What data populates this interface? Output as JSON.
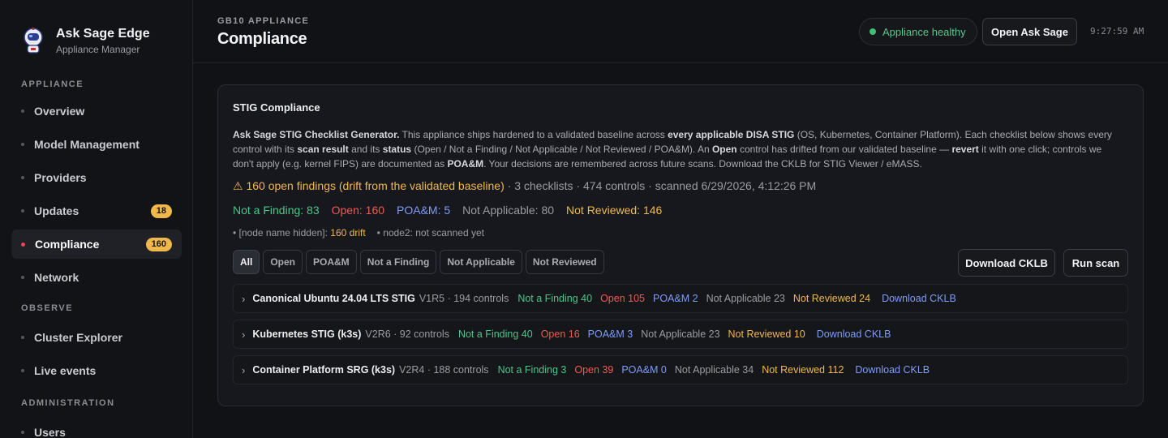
{
  "brand": {
    "title": "Ask Sage Edge",
    "subtitle": "Appliance Manager",
    "logo_icon": "astronaut-logo"
  },
  "sidebar": {
    "sections": [
      {
        "label": "APPLIANCE"
      },
      {
        "label": "OBSERVE"
      },
      {
        "label": "ADMINISTRATION"
      }
    ],
    "items": [
      {
        "label": "Overview"
      },
      {
        "label": "Model Management"
      },
      {
        "label": "Providers"
      },
      {
        "label": "Updates",
        "badge": "18"
      },
      {
        "label": "Compliance",
        "badge": "160",
        "active": true
      },
      {
        "label": "Network"
      },
      {
        "label": "Cluster Explorer"
      },
      {
        "label": "Live events"
      },
      {
        "label": "Users"
      }
    ]
  },
  "header": {
    "eyebrow": "GB10 APPLIANCE",
    "title": "Compliance",
    "health": "Appliance healthy",
    "open_button": "Open Ask Sage",
    "time": "9:27:59 AM"
  },
  "card": {
    "title": "STIG Compliance",
    "desc": {
      "p1": "Ask Sage STIG Checklist Generator.",
      "p2": " This appliance ships hardened to a validated baseline across ",
      "p3": "every applicable DISA STIG",
      "p4": " (OS, Kubernetes, Container Platform). Each checklist below shows every control with its ",
      "p5": "scan result",
      "p6": " and its ",
      "p7": "status",
      "p8": " (Open / Not a Finding / Not Applicable / Not Reviewed / POA&M). An ",
      "p9": "Open",
      "p10": " control has drifted from our validated baseline — ",
      "p11": "revert",
      "p12": " it with one click; controls we don't apply (e.g. kernel FIPS) are documented as ",
      "p13": "POA&M",
      "p14": ". Your decisions are remembered across future scans. Download the CKLB for STIG Viewer / eMASS."
    },
    "alert": {
      "warning": "⚠ 160 open findings (drift from the validated baseline)",
      "rest": " · 3 checklists · 474 controls · scanned 6/29/2026, 4:12:26 PM"
    },
    "counts": {
      "not_a_finding": "Not a Finding: 83",
      "open": "Open: 160",
      "poam": "POA&M: 5",
      "not_applicable": "Not Applicable: 80",
      "not_reviewed": "Not Reviewed: 146"
    },
    "nodes": {
      "node1_label": "• [node name hidden]: ",
      "node1_drift": "160 drift",
      "node2": "• node2: not scanned yet"
    },
    "filters": [
      "All",
      "Open",
      "POA&M",
      "Not a Finding",
      "Not Applicable",
      "Not Reviewed"
    ],
    "download_button": "Download CKLB",
    "scan_button": "Run scan",
    "checklists": [
      {
        "name": "Canonical Ubuntu 24.04 LTS STIG",
        "meta": "V1R5 · 194 controls",
        "naf": "Not a Finding 40",
        "open": "Open 105",
        "poam": "POA&M 2",
        "na": "Not Applicable 23",
        "nr": "Not Reviewed 24",
        "link": "Download CKLB"
      },
      {
        "name": "Kubernetes STIG (k3s)",
        "meta": "V2R6 · 92 controls",
        "naf": "Not a Finding 40",
        "open": "Open 16",
        "poam": "POA&M 3",
        "na": "Not Applicable 23",
        "nr": "Not Reviewed 10",
        "link": "Download CKLB"
      },
      {
        "name": "Container Platform SRG (k3s)",
        "meta": "V2R4 · 188 controls",
        "naf": "Not a Finding 3",
        "open": "Open 39",
        "poam": "POA&M 0",
        "na": "Not Applicable 34",
        "nr": "Not Reviewed 112",
        "link": "Download CKLB"
      }
    ]
  },
  "colors": {
    "accent_green": "#4cc58a",
    "accent_red": "#ee5a52",
    "accent_blue": "#7f9cf5",
    "accent_amber": "#f0b84a",
    "background": "#111216"
  }
}
